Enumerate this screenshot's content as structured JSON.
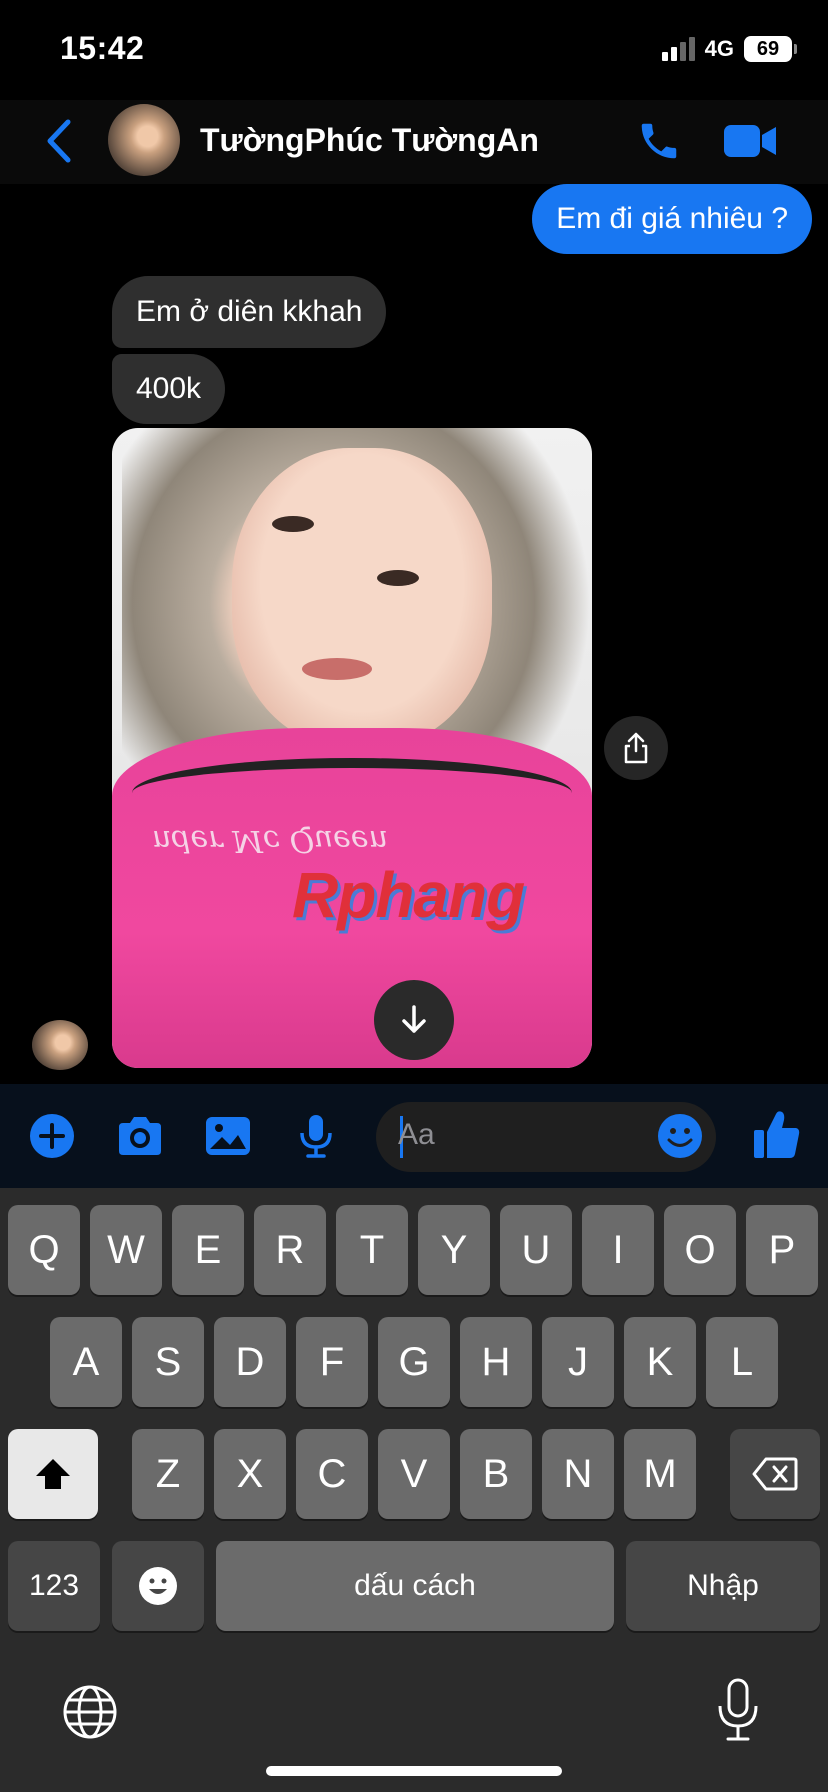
{
  "status_bar": {
    "time": "15:42",
    "network": "4G",
    "battery": "69"
  },
  "header": {
    "contact_name": "TườngPhúc TườngAn"
  },
  "messages": {
    "outgoing": "Em đi giá nhiêu ?",
    "incoming": [
      "Em ở diên kkhah",
      "400k"
    ],
    "image_watermark": "Rphang",
    "image_shirt_text": "nder Mc Queen"
  },
  "composer": {
    "placeholder": "Aa"
  },
  "keyboard": {
    "row1": [
      "Q",
      "W",
      "E",
      "R",
      "T",
      "Y",
      "U",
      "I",
      "O",
      "P"
    ],
    "row2": [
      "A",
      "S",
      "D",
      "F",
      "G",
      "H",
      "J",
      "K",
      "L"
    ],
    "row3": [
      "Z",
      "X",
      "C",
      "V",
      "B",
      "N",
      "M"
    ],
    "numbers": "123",
    "space": "dấu cách",
    "return": "Nhập"
  },
  "colors": {
    "accent": "#1877f2",
    "bubble_in": "#2f2f2f",
    "keyboard_bg": "#2b2b2b"
  },
  "icons": [
    "back-chevron",
    "phone",
    "video-camera",
    "plus-circle",
    "camera",
    "image",
    "microphone",
    "smiley",
    "thumbs-up",
    "share",
    "download-arrow",
    "shift-arrow",
    "backspace",
    "globe",
    "emoji-face",
    "dictation-mic"
  ]
}
